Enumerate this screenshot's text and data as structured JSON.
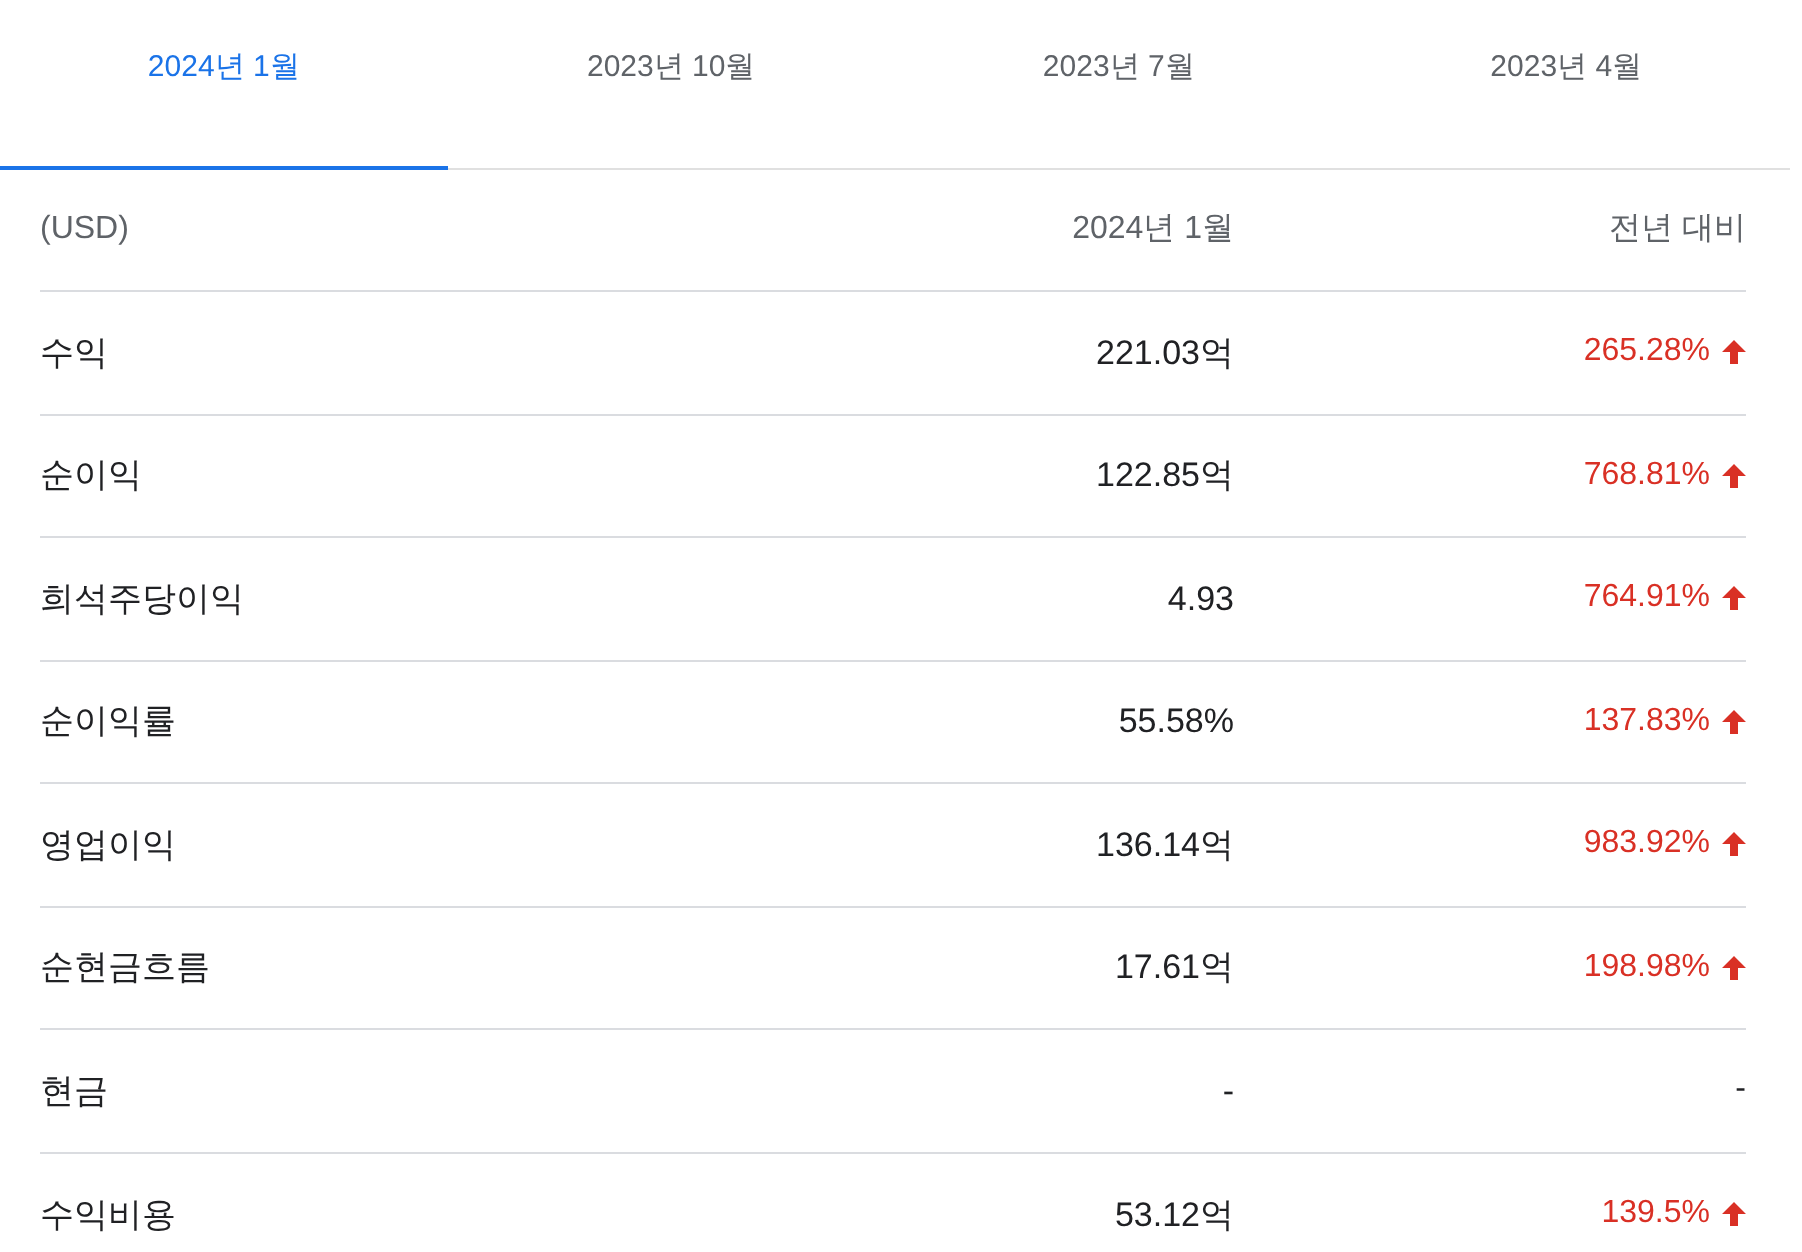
{
  "tabs": [
    {
      "label": "2024년 1월",
      "selected": true
    },
    {
      "label": "2023년 10월",
      "selected": false
    },
    {
      "label": "2023년 7월",
      "selected": false
    },
    {
      "label": "2023년 4월",
      "selected": false
    }
  ],
  "table": {
    "columns": [
      "(USD)",
      "2024년 1월",
      "전년 대비"
    ],
    "rows": [
      {
        "label": "수익",
        "value": "221.03억",
        "change": "265.28%",
        "kind": "up"
      },
      {
        "label": "순이익",
        "value": "122.85억",
        "change": "768.81%",
        "kind": "up"
      },
      {
        "label": "희석주당이익",
        "value": "4.93",
        "change": "764.91%",
        "kind": "up"
      },
      {
        "label": "순이익률",
        "value": "55.58%",
        "change": "137.83%",
        "kind": "up"
      },
      {
        "label": "영업이익",
        "value": "136.14억",
        "change": "983.92%",
        "kind": "up"
      },
      {
        "label": "순현금흐름",
        "value": "17.61억",
        "change": "198.98%",
        "kind": "up"
      },
      {
        "label": "현금",
        "value": "-",
        "change": "-",
        "kind": "flat"
      },
      {
        "label": "수익비용",
        "value": "53.12억",
        "change": "139.5%",
        "kind": "up"
      }
    ]
  }
}
